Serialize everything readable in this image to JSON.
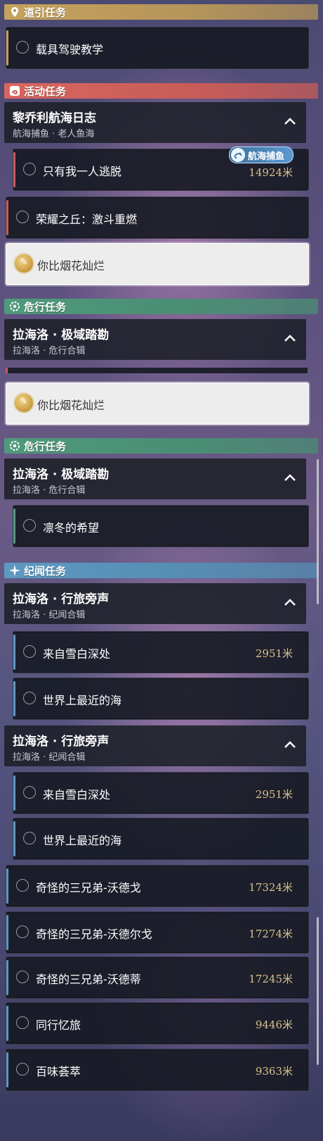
{
  "colors": {
    "guide": "#c5a25d",
    "activity": "#d8665e",
    "danger": "#4f9a7c",
    "chronicle": "#5d9ac2",
    "distance": "#d8c08a"
  },
  "sections": {
    "guide": {
      "title": "道引任务",
      "icon": "map-pin-icon"
    },
    "activity": {
      "title": "活动任务",
      "icon": "activity-swirl-icon"
    },
    "danger": {
      "title": "危行任务",
      "icon": "gear-eye-icon"
    },
    "chronicle": {
      "title": "纪闻任务",
      "icon": "sparkle-icon"
    }
  },
  "quests": {
    "vehicle": {
      "label": "载具驾驶教学"
    },
    "escape": {
      "label": "只有我一人逃脱",
      "distance": "14924米"
    },
    "glory": {
      "label": "荣耀之丘：激斗重燃"
    },
    "fireworks": {
      "label": "你比烟花灿烂",
      "medal_glyph": "✎"
    },
    "winter": {
      "label": "凛冬的希望"
    },
    "snow": {
      "label": "来自雪白深处",
      "distance": "2951米"
    },
    "sea": {
      "label": "世界上最近的海"
    },
    "wadego": {
      "label": "奇怪的三兄弟-沃德戈",
      "distance": "17324米"
    },
    "wadeerge": {
      "label": "奇怪的三兄弟-沃德尔戈",
      "distance": "17274米"
    },
    "wadedi": {
      "label": "奇怪的三兄弟-沃德蒂",
      "distance": "17245米"
    },
    "journey": {
      "label": "同行忆旅",
      "distance": "9446米"
    },
    "flavors": {
      "label": "百味荟萃",
      "distance": "9363米"
    }
  },
  "groups": {
    "logbook": {
      "title": "黎乔利航海日志",
      "subtitle": "航海捕鱼 · 老人鱼海"
    },
    "polar": {
      "title": "拉海洛 · 极域踏勘",
      "subtitle": "拉海洛 · 危行合辑"
    },
    "travel": {
      "title": "拉海洛 · 行旅旁声",
      "subtitle": "拉海洛 · 纪闻合辑"
    }
  },
  "tag": {
    "label": "航海捕鱼",
    "icon": "fishing-icon"
  }
}
